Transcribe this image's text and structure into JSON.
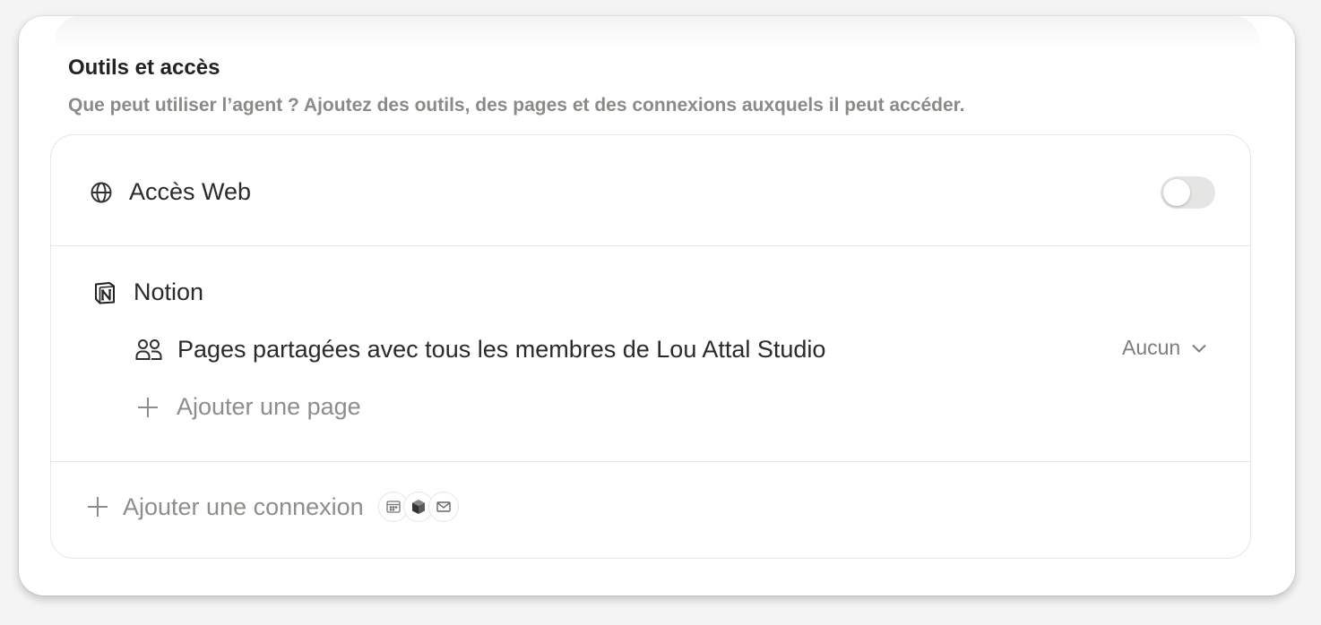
{
  "section": {
    "title": "Outils et accès",
    "subtitle": "Que peut utiliser l’agent ? Ajoutez des outils, des pages et des connexions auxquels il peut accéder."
  },
  "web_access": {
    "label": "Accès Web",
    "icon": "globe-icon",
    "enabled": false
  },
  "notion": {
    "label": "Notion",
    "icon": "notion-logo-icon",
    "pages": [
      {
        "label": "Pages partagées avec tous les membres de Lou Attal Studio",
        "icon": "people-icon",
        "permission": "Aucun"
      }
    ],
    "add_page_label": "Ajouter une page"
  },
  "connections": {
    "add_label": "Ajouter une connexion",
    "icons": [
      "calendar-icon",
      "cube-icon",
      "mail-icon"
    ]
  },
  "colors": {
    "panel_bg": "#ffffff",
    "page_bg": "#f4f4f4",
    "text_primary": "#2a2a2a",
    "text_muted": "#8d8d8a",
    "toggle_off": "#e5e5e3"
  }
}
